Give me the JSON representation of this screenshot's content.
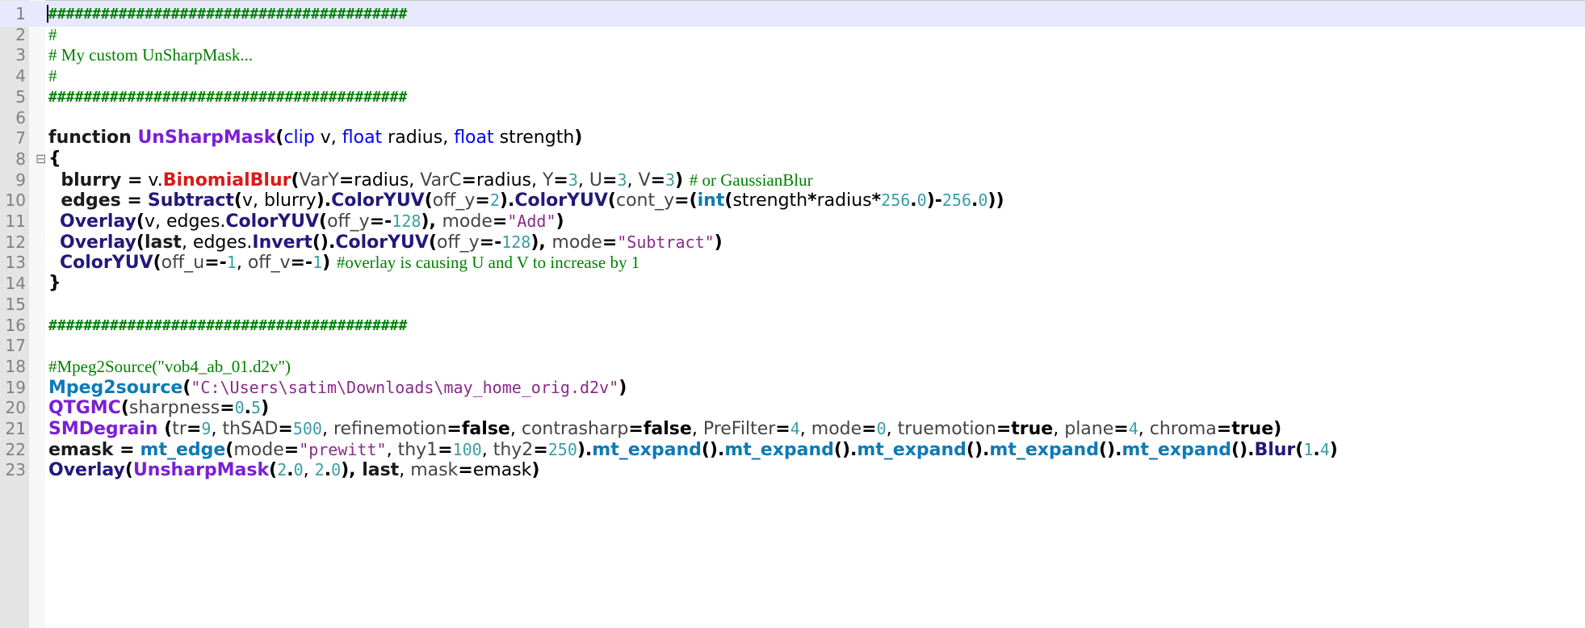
{
  "editor": {
    "lines": [
      {
        "n": "1",
        "current": true,
        "fold": "",
        "tokens": [
          {
            "t": "#########################################",
            "c": "hash"
          }
        ]
      },
      {
        "n": "2",
        "fold": "",
        "tokens": [
          {
            "t": "#",
            "c": "cmt"
          }
        ]
      },
      {
        "n": "3",
        "fold": "",
        "tokens": [
          {
            "t": "# My custom UnSharpMask...",
            "c": "cmt"
          }
        ]
      },
      {
        "n": "4",
        "fold": "",
        "tokens": [
          {
            "t": "#",
            "c": "cmt"
          }
        ]
      },
      {
        "n": "5",
        "fold": "",
        "tokens": [
          {
            "t": "#########################################",
            "c": "hash"
          }
        ]
      },
      {
        "n": "6",
        "fold": "",
        "tokens": []
      },
      {
        "n": "7",
        "fold": "",
        "tokens": [
          {
            "t": "function ",
            "c": "kw"
          },
          {
            "t": "UnSharpMask",
            "c": "fnname"
          },
          {
            "t": "(",
            "c": "op"
          },
          {
            "t": "clip",
            "c": "type"
          },
          {
            "t": " v, ",
            "c": "txt"
          },
          {
            "t": "float",
            "c": "type"
          },
          {
            "t": " radius, ",
            "c": "txt"
          },
          {
            "t": "float",
            "c": "type"
          },
          {
            "t": " strength",
            "c": "txt"
          },
          {
            "t": ")",
            "c": "op"
          }
        ]
      },
      {
        "n": "8",
        "fold": "⊟",
        "tokens": [
          {
            "t": "{",
            "c": "op"
          }
        ]
      },
      {
        "n": "9",
        "fold": "",
        "tokens": [
          {
            "t": "  blurry ",
            "c": "kw"
          },
          {
            "t": "=",
            "c": "op"
          },
          {
            "t": " v.",
            "c": "txt"
          },
          {
            "t": "BinomialBlur",
            "c": "red"
          },
          {
            "t": "(",
            "c": "op"
          },
          {
            "t": "VarY",
            "c": "param"
          },
          {
            "t": "=",
            "c": "op"
          },
          {
            "t": "radius, ",
            "c": "txt"
          },
          {
            "t": "VarC",
            "c": "param"
          },
          {
            "t": "=",
            "c": "op"
          },
          {
            "t": "radius, ",
            "c": "txt"
          },
          {
            "t": "Y",
            "c": "param"
          },
          {
            "t": "=",
            "c": "op"
          },
          {
            "t": "3",
            "c": "num"
          },
          {
            "t": ", ",
            "c": "txt"
          },
          {
            "t": "U",
            "c": "param"
          },
          {
            "t": "=",
            "c": "op"
          },
          {
            "t": "3",
            "c": "num"
          },
          {
            "t": ", ",
            "c": "txt"
          },
          {
            "t": "V",
            "c": "param"
          },
          {
            "t": "=",
            "c": "op"
          },
          {
            "t": "3",
            "c": "num"
          },
          {
            "t": ") ",
            "c": "op"
          },
          {
            "t": "# or GaussianBlur",
            "c": "cmt"
          }
        ]
      },
      {
        "n": "10",
        "fold": "",
        "tokens": [
          {
            "t": "  edges ",
            "c": "kw"
          },
          {
            "t": "=",
            "c": "op"
          },
          {
            "t": " ",
            "c": "txt"
          },
          {
            "t": "Subtract",
            "c": "filter"
          },
          {
            "t": "(",
            "c": "op"
          },
          {
            "t": "v, blurry",
            "c": "txt"
          },
          {
            "t": ").",
            "c": "op"
          },
          {
            "t": "ColorYUV",
            "c": "filter"
          },
          {
            "t": "(",
            "c": "op"
          },
          {
            "t": "off_y",
            "c": "param"
          },
          {
            "t": "=",
            "c": "op"
          },
          {
            "t": "2",
            "c": "num"
          },
          {
            "t": ").",
            "c": "op"
          },
          {
            "t": "ColorYUV",
            "c": "filter"
          },
          {
            "t": "(",
            "c": "op"
          },
          {
            "t": "cont_y",
            "c": "param"
          },
          {
            "t": "=(",
            "c": "op"
          },
          {
            "t": "int",
            "c": "ext"
          },
          {
            "t": "(",
            "c": "op"
          },
          {
            "t": "strength",
            "c": "txt"
          },
          {
            "t": "*",
            "c": "op"
          },
          {
            "t": "radius",
            "c": "txt"
          },
          {
            "t": "*",
            "c": "op"
          },
          {
            "t": "256",
            "c": "num"
          },
          {
            "t": ".",
            "c": "op"
          },
          {
            "t": "0",
            "c": "num"
          },
          {
            "t": ")-",
            "c": "op"
          },
          {
            "t": "256",
            "c": "num"
          },
          {
            "t": ".",
            "c": "op"
          },
          {
            "t": "0",
            "c": "num"
          },
          {
            "t": "))",
            "c": "op"
          }
        ]
      },
      {
        "n": "11",
        "fold": "",
        "tokens": [
          {
            "t": "  ",
            "c": "txt"
          },
          {
            "t": "Overlay",
            "c": "filter"
          },
          {
            "t": "(",
            "c": "op"
          },
          {
            "t": "v, edges.",
            "c": "txt"
          },
          {
            "t": "ColorYUV",
            "c": "filter"
          },
          {
            "t": "(",
            "c": "op"
          },
          {
            "t": "off_y",
            "c": "param"
          },
          {
            "t": "=-",
            "c": "op"
          },
          {
            "t": "128",
            "c": "num"
          },
          {
            "t": "), ",
            "c": "op"
          },
          {
            "t": "mode",
            "c": "param"
          },
          {
            "t": "=",
            "c": "op"
          },
          {
            "t": "\"Add\"",
            "c": "str"
          },
          {
            "t": ")",
            "c": "op"
          }
        ]
      },
      {
        "n": "12",
        "fold": "",
        "tokens": [
          {
            "t": "  ",
            "c": "txt"
          },
          {
            "t": "Overlay",
            "c": "filter"
          },
          {
            "t": "(",
            "c": "op"
          },
          {
            "t": "last",
            "c": "kw"
          },
          {
            "t": ", edges.",
            "c": "txt"
          },
          {
            "t": "Invert",
            "c": "filter"
          },
          {
            "t": "().",
            "c": "op"
          },
          {
            "t": "ColorYUV",
            "c": "filter"
          },
          {
            "t": "(",
            "c": "op"
          },
          {
            "t": "off_y",
            "c": "param"
          },
          {
            "t": "=-",
            "c": "op"
          },
          {
            "t": "128",
            "c": "num"
          },
          {
            "t": "), ",
            "c": "op"
          },
          {
            "t": "mode",
            "c": "param"
          },
          {
            "t": "=",
            "c": "op"
          },
          {
            "t": "\"Subtract\"",
            "c": "str"
          },
          {
            "t": ")",
            "c": "op"
          }
        ]
      },
      {
        "n": "13",
        "fold": "",
        "tokens": [
          {
            "t": "  ",
            "c": "txt"
          },
          {
            "t": "ColorYUV",
            "c": "filter"
          },
          {
            "t": "(",
            "c": "op"
          },
          {
            "t": "off_u",
            "c": "param"
          },
          {
            "t": "=-",
            "c": "op"
          },
          {
            "t": "1",
            "c": "num"
          },
          {
            "t": ", ",
            "c": "txt"
          },
          {
            "t": "off_v",
            "c": "param"
          },
          {
            "t": "=-",
            "c": "op"
          },
          {
            "t": "1",
            "c": "num"
          },
          {
            "t": ") ",
            "c": "op"
          },
          {
            "t": "#overlay is causing U and V to increase by 1",
            "c": "cmt"
          }
        ]
      },
      {
        "n": "14",
        "fold": "",
        "tokens": [
          {
            "t": "}",
            "c": "op"
          }
        ]
      },
      {
        "n": "15",
        "fold": "",
        "tokens": []
      },
      {
        "n": "16",
        "fold": "",
        "tokens": [
          {
            "t": "#########################################",
            "c": "hash"
          }
        ]
      },
      {
        "n": "17",
        "fold": "",
        "tokens": []
      },
      {
        "n": "18",
        "fold": "",
        "tokens": [
          {
            "t": "#Mpeg2Source(\"vob4_ab_01.d2v\")",
            "c": "cmt"
          }
        ]
      },
      {
        "n": "19",
        "fold": "",
        "tokens": [
          {
            "t": "Mpeg2source",
            "c": "ext"
          },
          {
            "t": "(",
            "c": "op"
          },
          {
            "t": "\"C:\\Users\\satim\\Downloads\\may_home_orig.d2v\"",
            "c": "str"
          },
          {
            "t": ")",
            "c": "op"
          }
        ]
      },
      {
        "n": "20",
        "fold": "",
        "tokens": [
          {
            "t": "QTGMC",
            "c": "purple"
          },
          {
            "t": "(",
            "c": "op"
          },
          {
            "t": "sharpness",
            "c": "param"
          },
          {
            "t": "=",
            "c": "op"
          },
          {
            "t": "0",
            "c": "num"
          },
          {
            "t": ".",
            "c": "op"
          },
          {
            "t": "5",
            "c": "num"
          },
          {
            "t": ")",
            "c": "op"
          }
        ]
      },
      {
        "n": "21",
        "fold": "",
        "tokens": [
          {
            "t": "SMDegrain",
            "c": "purple"
          },
          {
            "t": " (",
            "c": "op"
          },
          {
            "t": "tr",
            "c": "param"
          },
          {
            "t": "=",
            "c": "op"
          },
          {
            "t": "9",
            "c": "num"
          },
          {
            "t": ", ",
            "c": "txt"
          },
          {
            "t": "thSAD",
            "c": "param"
          },
          {
            "t": "=",
            "c": "op"
          },
          {
            "t": "500",
            "c": "num"
          },
          {
            "t": ", ",
            "c": "txt"
          },
          {
            "t": "refinemotion",
            "c": "param"
          },
          {
            "t": "=",
            "c": "op"
          },
          {
            "t": "false",
            "c": "bool"
          },
          {
            "t": ", ",
            "c": "txt"
          },
          {
            "t": "contrasharp",
            "c": "param"
          },
          {
            "t": "=",
            "c": "op"
          },
          {
            "t": "false",
            "c": "bool"
          },
          {
            "t": ", ",
            "c": "txt"
          },
          {
            "t": "PreFilter",
            "c": "param"
          },
          {
            "t": "=",
            "c": "op"
          },
          {
            "t": "4",
            "c": "num"
          },
          {
            "t": ", ",
            "c": "txt"
          },
          {
            "t": "mode",
            "c": "param"
          },
          {
            "t": "=",
            "c": "op"
          },
          {
            "t": "0",
            "c": "num"
          },
          {
            "t": ", ",
            "c": "txt"
          },
          {
            "t": "truemotion",
            "c": "param"
          },
          {
            "t": "=",
            "c": "op"
          },
          {
            "t": "true",
            "c": "bool"
          },
          {
            "t": ", ",
            "c": "txt"
          },
          {
            "t": "plane",
            "c": "param"
          },
          {
            "t": "=",
            "c": "op"
          },
          {
            "t": "4",
            "c": "num"
          },
          {
            "t": ", ",
            "c": "txt"
          },
          {
            "t": "chroma",
            "c": "param"
          },
          {
            "t": "=",
            "c": "op"
          },
          {
            "t": "true",
            "c": "bool"
          },
          {
            "t": ")",
            "c": "op"
          }
        ]
      },
      {
        "n": "22",
        "fold": "",
        "tokens": [
          {
            "t": "emask ",
            "c": "kw"
          },
          {
            "t": "=",
            "c": "op"
          },
          {
            "t": " ",
            "c": "txt"
          },
          {
            "t": "mt_edge",
            "c": "ext"
          },
          {
            "t": "(",
            "c": "op"
          },
          {
            "t": "mode",
            "c": "param"
          },
          {
            "t": "=",
            "c": "op"
          },
          {
            "t": "\"prewitt\"",
            "c": "str"
          },
          {
            "t": ", ",
            "c": "txt"
          },
          {
            "t": "thy1",
            "c": "param"
          },
          {
            "t": "=",
            "c": "op"
          },
          {
            "t": "100",
            "c": "num"
          },
          {
            "t": ", ",
            "c": "txt"
          },
          {
            "t": "thy2",
            "c": "param"
          },
          {
            "t": "=",
            "c": "op"
          },
          {
            "t": "250",
            "c": "num"
          },
          {
            "t": ").",
            "c": "op"
          },
          {
            "t": "mt_expand",
            "c": "ext"
          },
          {
            "t": "().",
            "c": "op"
          },
          {
            "t": "mt_expand",
            "c": "ext"
          },
          {
            "t": "().",
            "c": "op"
          },
          {
            "t": "mt_expand",
            "c": "ext"
          },
          {
            "t": "().",
            "c": "op"
          },
          {
            "t": "mt_expand",
            "c": "ext"
          },
          {
            "t": "().",
            "c": "op"
          },
          {
            "t": "mt_expand",
            "c": "ext"
          },
          {
            "t": "().",
            "c": "op"
          },
          {
            "t": "Blur",
            "c": "filter"
          },
          {
            "t": "(",
            "c": "op"
          },
          {
            "t": "1",
            "c": "num"
          },
          {
            "t": ".",
            "c": "op"
          },
          {
            "t": "4",
            "c": "num"
          },
          {
            "t": ")",
            "c": "op"
          }
        ]
      },
      {
        "n": "23",
        "fold": "",
        "tokens": [
          {
            "t": "Overlay",
            "c": "filter"
          },
          {
            "t": "(",
            "c": "op"
          },
          {
            "t": "UnsharpMask",
            "c": "purple"
          },
          {
            "t": "(",
            "c": "op"
          },
          {
            "t": "2",
            "c": "num"
          },
          {
            "t": ".",
            "c": "op"
          },
          {
            "t": "0",
            "c": "num"
          },
          {
            "t": ", ",
            "c": "txt"
          },
          {
            "t": "2",
            "c": "num"
          },
          {
            "t": ".",
            "c": "op"
          },
          {
            "t": "0",
            "c": "num"
          },
          {
            "t": "), ",
            "c": "op"
          },
          {
            "t": "last",
            "c": "kw"
          },
          {
            "t": ", ",
            "c": "txt"
          },
          {
            "t": "mask",
            "c": "param"
          },
          {
            "t": "=",
            "c": "op"
          },
          {
            "t": "emask",
            "c": "txt"
          },
          {
            "t": ")",
            "c": "op"
          }
        ]
      }
    ]
  }
}
